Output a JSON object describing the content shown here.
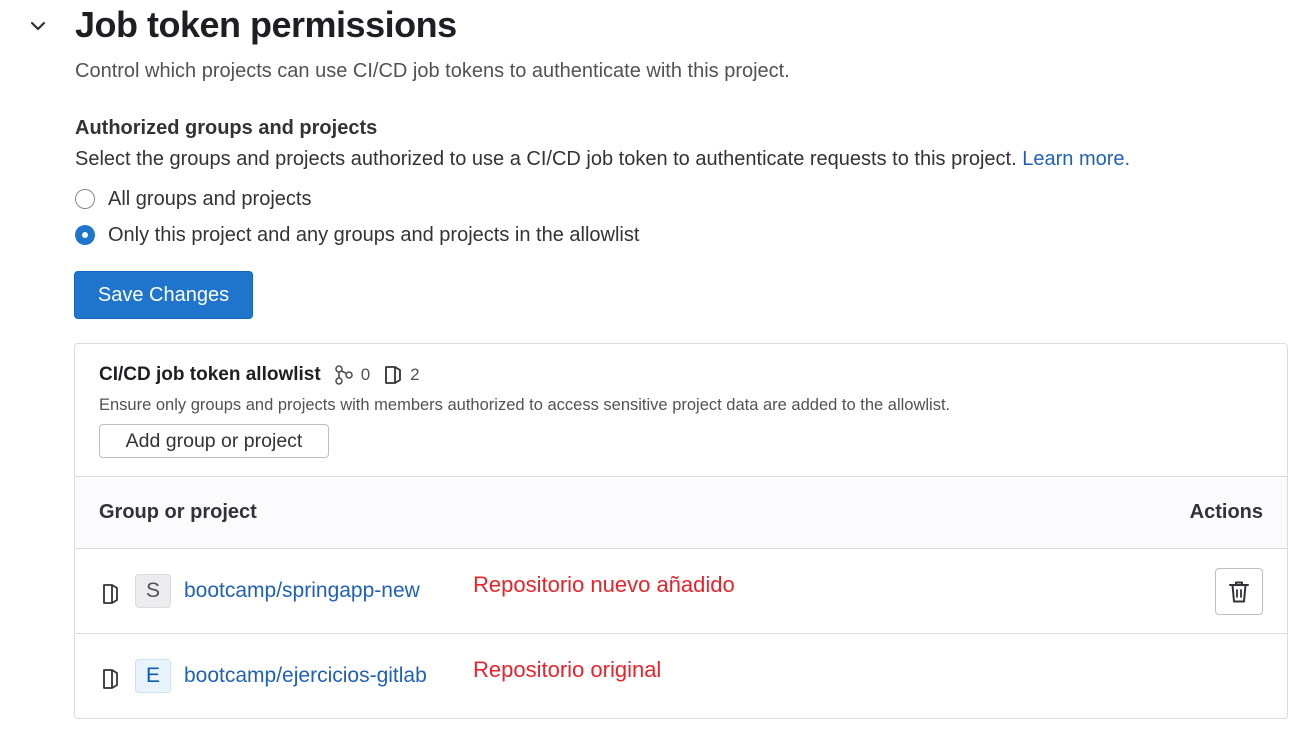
{
  "section": {
    "title": "Job token permissions",
    "description": "Control which projects can use CI/CD job tokens to authenticate with this project."
  },
  "authorized": {
    "heading": "Authorized groups and projects",
    "help_text": "Select the groups and projects authorized to use a CI/CD job token to authenticate requests to this project.",
    "learn_more": "Learn more.",
    "options": [
      {
        "label": "All groups and projects",
        "checked": false
      },
      {
        "label": "Only this project and any groups and projects in the allowlist",
        "checked": true
      }
    ],
    "save_label": "Save Changes"
  },
  "allowlist": {
    "title": "CI/CD job token allowlist",
    "group_count": "0",
    "project_count": "2",
    "description": "Ensure only groups and projects with members authorized to access sensitive project data are added to the allowlist.",
    "add_label": "Add group or project",
    "columns": {
      "group_or_project": "Group or project",
      "actions": "Actions"
    },
    "rows": [
      {
        "avatar": "S",
        "path": "bootcamp/springapp-new",
        "annotation": "Repositorio nuevo añadido"
      },
      {
        "avatar": "E",
        "path": "bootcamp/ejercicios-gitlab",
        "annotation": "Repositorio original"
      }
    ]
  },
  "icons": {
    "collapse": "chevron-down-icon",
    "groups": "group-icon",
    "projects": "project-icon",
    "delete": "trash-icon"
  },
  "colors": {
    "primary": "#1f75cb",
    "link": "#1f61b8",
    "annotation": "#e8232b"
  }
}
